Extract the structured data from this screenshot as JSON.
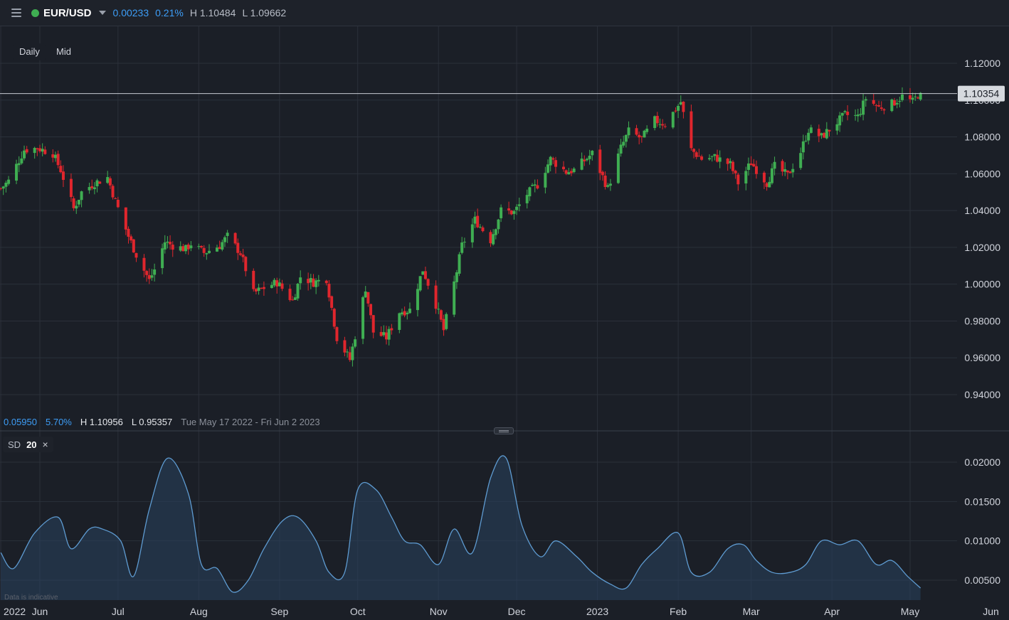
{
  "header": {
    "symbol": "EUR/USD",
    "status_color": "#3fae52",
    "change": "0.00233",
    "change_pct": "0.21%",
    "high": "H 1.10484",
    "low": "L 1.09662",
    "menu_icon": "hamburger-menu-icon",
    "dropdown_icon": "caret-down-icon"
  },
  "controls": {
    "interval": "Daily",
    "price_type": "Mid"
  },
  "range_stats": {
    "change": "0.05950",
    "change_pct": "5.70%",
    "high": "H 1.10956",
    "low": "L 0.95357",
    "date_range": "Tue May 17 2022 - Fri Jun 2 2023"
  },
  "indicator": {
    "name": "SD",
    "period": "20",
    "close_glyph": "×"
  },
  "footer_note": "Data is indicative",
  "colors": {
    "up": "#3fae52",
    "down": "#e0262d",
    "sd_line": "#5e9bd1",
    "blue_text": "#3d9df6"
  },
  "chart_data": [
    {
      "type": "candlestick",
      "title": "EUR/USD",
      "interval": "Daily",
      "ylim": [
        0.925,
        1.125
      ],
      "y_ticks": [
        "1.12000",
        "1.10000",
        "1.08000",
        "1.06000",
        "1.04000",
        "1.02000",
        "1.00000",
        "0.98000",
        "0.96000",
        "0.94000"
      ],
      "current_price": "1.10354",
      "x_labels": [
        "2022",
        "Jun",
        "Jul",
        "Aug",
        "Sep",
        "Oct",
        "Nov",
        "Dec",
        "2023",
        "Feb",
        "Mar",
        "Apr",
        "May",
        "Jun"
      ],
      "x_label_dates": [
        "2022-05-17",
        "2022-06-01",
        "2022-07-01",
        "2022-08-01",
        "2022-09-01",
        "2022-10-01",
        "2022-11-01",
        "2022-12-01",
        "2023-01-01",
        "2023-02-01",
        "2023-03-01",
        "2023-04-01",
        "2023-05-01",
        "2023-06-01"
      ],
      "grid": true,
      "close_anchors": [
        [
          "2022-05-17",
          1.052
        ],
        [
          "2022-05-20",
          1.056
        ],
        [
          "2022-05-26",
          1.073
        ],
        [
          "2022-05-31",
          1.074
        ],
        [
          "2022-06-06",
          1.071
        ],
        [
          "2022-06-09",
          1.062
        ],
        [
          "2022-06-14",
          1.041
        ],
        [
          "2022-06-17",
          1.05
        ],
        [
          "2022-06-22",
          1.055
        ],
        [
          "2022-06-27",
          1.058
        ],
        [
          "2022-06-30",
          1.045
        ],
        [
          "2022-07-05",
          1.026
        ],
        [
          "2022-07-08",
          1.016
        ],
        [
          "2022-07-13",
          1.002
        ],
        [
          "2022-07-15",
          1.008
        ],
        [
          "2022-07-19",
          1.023
        ],
        [
          "2022-07-22",
          1.021
        ],
        [
          "2022-07-27",
          1.019
        ],
        [
          "2022-07-29",
          1.022
        ],
        [
          "2022-08-03",
          1.017
        ],
        [
          "2022-08-09",
          1.021
        ],
        [
          "2022-08-12",
          1.026
        ],
        [
          "2022-08-17",
          1.017
        ],
        [
          "2022-08-22",
          0.995
        ],
        [
          "2022-08-26",
          0.998
        ],
        [
          "2022-08-31",
          1.001
        ],
        [
          "2022-09-06",
          0.991
        ],
        [
          "2022-09-09",
          1.004
        ],
        [
          "2022-09-14",
          1.001
        ],
        [
          "2022-09-19",
          1.003
        ],
        [
          "2022-09-23",
          0.971
        ],
        [
          "2022-09-28",
          0.959
        ],
        [
          "2022-10-04",
          0.998
        ],
        [
          "2022-10-07",
          0.974
        ],
        [
          "2022-10-12",
          0.971
        ],
        [
          "2022-10-17",
          0.985
        ],
        [
          "2022-10-21",
          0.986
        ],
        [
          "2022-10-26",
          1.008
        ],
        [
          "2022-10-31",
          0.989
        ],
        [
          "2022-11-03",
          0.975
        ],
        [
          "2022-11-08",
          1.007
        ],
        [
          "2022-11-10",
          1.021
        ],
        [
          "2022-11-15",
          1.035
        ],
        [
          "2022-11-21",
          1.024
        ],
        [
          "2022-11-25",
          1.04
        ],
        [
          "2022-11-30",
          1.039
        ],
        [
          "2022-12-05",
          1.049
        ],
        [
          "2022-12-09",
          1.054
        ],
        [
          "2022-12-14",
          1.068
        ],
        [
          "2022-12-20",
          1.061
        ],
        [
          "2022-12-23",
          1.062
        ],
        [
          "2022-12-30",
          1.071
        ],
        [
          "2023-01-05",
          1.052
        ],
        [
          "2023-01-10",
          1.074
        ],
        [
          "2023-01-13",
          1.083
        ],
        [
          "2023-01-18",
          1.079
        ],
        [
          "2023-01-23",
          1.089
        ],
        [
          "2023-01-27",
          1.087
        ],
        [
          "2023-02-02",
          1.099
        ],
        [
          "2023-02-06",
          1.073
        ],
        [
          "2023-02-10",
          1.068
        ],
        [
          "2023-02-15",
          1.069
        ],
        [
          "2023-02-21",
          1.065
        ],
        [
          "2023-02-24",
          1.055
        ],
        [
          "2023-03-01",
          1.066
        ],
        [
          "2023-03-07",
          1.055
        ],
        [
          "2023-03-10",
          1.064
        ],
        [
          "2023-03-15",
          1.059
        ],
        [
          "2023-03-20",
          1.072
        ],
        [
          "2023-03-23",
          1.084
        ],
        [
          "2023-03-28",
          1.08
        ],
        [
          "2023-04-03",
          1.088
        ],
        [
          "2023-04-06",
          1.092
        ],
        [
          "2023-04-11",
          1.091
        ],
        [
          "2023-04-14",
          1.101
        ],
        [
          "2023-04-19",
          1.096
        ],
        [
          "2023-04-24",
          1.098
        ],
        [
          "2023-04-28",
          1.102
        ],
        [
          "2023-05-02",
          1.099
        ],
        [
          "2023-05-04",
          1.103
        ],
        [
          "2023-05-05",
          1.102
        ]
      ]
    },
    {
      "type": "area",
      "title": "SD 20",
      "ylim": [
        0.0025,
        0.0225
      ],
      "y_ticks": [
        "0.02000",
        "0.01500",
        "0.01000",
        "0.00500"
      ],
      "x": [
        "2022-05-17",
        "2022-05-22",
        "2022-05-30",
        "2022-06-08",
        "2022-06-13",
        "2022-06-20",
        "2022-06-25",
        "2022-07-02",
        "2022-07-07",
        "2022-07-13",
        "2022-07-20",
        "2022-07-28",
        "2022-08-02",
        "2022-08-08",
        "2022-08-14",
        "2022-08-20",
        "2022-08-26",
        "2022-09-02",
        "2022-09-08",
        "2022-09-15",
        "2022-09-20",
        "2022-09-26",
        "2022-10-01",
        "2022-10-08",
        "2022-10-14",
        "2022-10-19",
        "2022-10-25",
        "2022-11-01",
        "2022-11-07",
        "2022-11-14",
        "2022-11-21",
        "2022-11-27",
        "2022-12-03",
        "2022-12-10",
        "2022-12-16",
        "2022-12-24",
        "2022-12-30",
        "2023-01-06",
        "2023-01-12",
        "2023-01-18",
        "2023-01-24",
        "2023-02-01",
        "2023-02-06",
        "2023-02-13",
        "2023-02-20",
        "2023-02-26",
        "2023-03-03",
        "2023-03-09",
        "2023-03-16",
        "2023-03-22",
        "2023-03-28",
        "2023-04-04",
        "2023-04-11",
        "2023-04-18",
        "2023-04-24",
        "2023-04-30",
        "2023-05-05"
      ],
      "values": [
        0.0085,
        0.0065,
        0.011,
        0.013,
        0.009,
        0.0115,
        0.0115,
        0.01,
        0.0055,
        0.014,
        0.0205,
        0.016,
        0.007,
        0.0065,
        0.0035,
        0.005,
        0.009,
        0.0125,
        0.013,
        0.01,
        0.006,
        0.006,
        0.0165,
        0.0165,
        0.013,
        0.01,
        0.0095,
        0.007,
        0.0115,
        0.0085,
        0.018,
        0.0205,
        0.012,
        0.008,
        0.01,
        0.008,
        0.006,
        0.0045,
        0.004,
        0.007,
        0.009,
        0.011,
        0.006,
        0.006,
        0.009,
        0.0095,
        0.0075,
        0.006,
        0.006,
        0.007,
        0.01,
        0.0095,
        0.01,
        0.007,
        0.0075,
        0.0055,
        0.004
      ]
    }
  ]
}
